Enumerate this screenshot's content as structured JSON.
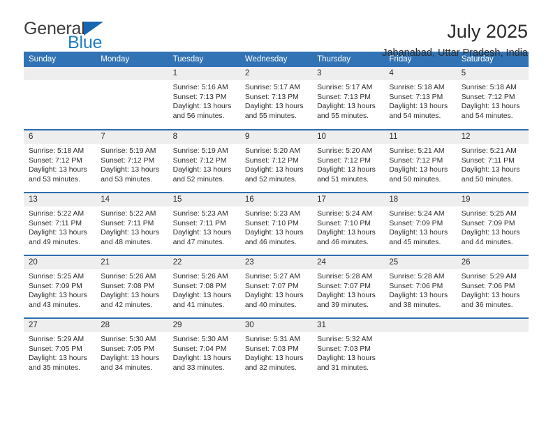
{
  "brand": {
    "name_top": "General",
    "name_bottom": "Blue",
    "triangle_color": "#1665b3",
    "blue_text_color": "#1f7ec4"
  },
  "header": {
    "title": "July 2025",
    "location": "Jahanabad, Uttar Pradesh, India"
  },
  "theme": {
    "header_row_bg": "#3273b5",
    "row_divider": "#2e6daf",
    "daynum_bg": "#eeeeee",
    "text": "#2b2b2b"
  },
  "weekday_headers": [
    "Sunday",
    "Monday",
    "Tuesday",
    "Wednesday",
    "Thursday",
    "Friday",
    "Saturday"
  ],
  "labels": {
    "sunrise_prefix": "Sunrise:",
    "sunset_prefix": "Sunset:",
    "daylight_prefix": "Daylight:"
  },
  "weeks": [
    [
      {
        "day": "",
        "lines": ""
      },
      {
        "day": "",
        "lines": ""
      },
      {
        "day": "1",
        "lines": "Sunrise: 5:16 AM\nSunset: 7:13 PM\nDaylight: 13 hours\nand 56 minutes."
      },
      {
        "day": "2",
        "lines": "Sunrise: 5:17 AM\nSunset: 7:13 PM\nDaylight: 13 hours\nand 55 minutes."
      },
      {
        "day": "3",
        "lines": "Sunrise: 5:17 AM\nSunset: 7:13 PM\nDaylight: 13 hours\nand 55 minutes."
      },
      {
        "day": "4",
        "lines": "Sunrise: 5:18 AM\nSunset: 7:13 PM\nDaylight: 13 hours\nand 54 minutes."
      },
      {
        "day": "5",
        "lines": "Sunrise: 5:18 AM\nSunset: 7:12 PM\nDaylight: 13 hours\nand 54 minutes."
      }
    ],
    [
      {
        "day": "6",
        "lines": "Sunrise: 5:18 AM\nSunset: 7:12 PM\nDaylight: 13 hours\nand 53 minutes."
      },
      {
        "day": "7",
        "lines": "Sunrise: 5:19 AM\nSunset: 7:12 PM\nDaylight: 13 hours\nand 53 minutes."
      },
      {
        "day": "8",
        "lines": "Sunrise: 5:19 AM\nSunset: 7:12 PM\nDaylight: 13 hours\nand 52 minutes."
      },
      {
        "day": "9",
        "lines": "Sunrise: 5:20 AM\nSunset: 7:12 PM\nDaylight: 13 hours\nand 52 minutes."
      },
      {
        "day": "10",
        "lines": "Sunrise: 5:20 AM\nSunset: 7:12 PM\nDaylight: 13 hours\nand 51 minutes."
      },
      {
        "day": "11",
        "lines": "Sunrise: 5:21 AM\nSunset: 7:12 PM\nDaylight: 13 hours\nand 50 minutes."
      },
      {
        "day": "12",
        "lines": "Sunrise: 5:21 AM\nSunset: 7:11 PM\nDaylight: 13 hours\nand 50 minutes."
      }
    ],
    [
      {
        "day": "13",
        "lines": "Sunrise: 5:22 AM\nSunset: 7:11 PM\nDaylight: 13 hours\nand 49 minutes."
      },
      {
        "day": "14",
        "lines": "Sunrise: 5:22 AM\nSunset: 7:11 PM\nDaylight: 13 hours\nand 48 minutes."
      },
      {
        "day": "15",
        "lines": "Sunrise: 5:23 AM\nSunset: 7:11 PM\nDaylight: 13 hours\nand 47 minutes."
      },
      {
        "day": "16",
        "lines": "Sunrise: 5:23 AM\nSunset: 7:10 PM\nDaylight: 13 hours\nand 46 minutes."
      },
      {
        "day": "17",
        "lines": "Sunrise: 5:24 AM\nSunset: 7:10 PM\nDaylight: 13 hours\nand 46 minutes."
      },
      {
        "day": "18",
        "lines": "Sunrise: 5:24 AM\nSunset: 7:09 PM\nDaylight: 13 hours\nand 45 minutes."
      },
      {
        "day": "19",
        "lines": "Sunrise: 5:25 AM\nSunset: 7:09 PM\nDaylight: 13 hours\nand 44 minutes."
      }
    ],
    [
      {
        "day": "20",
        "lines": "Sunrise: 5:25 AM\nSunset: 7:09 PM\nDaylight: 13 hours\nand 43 minutes."
      },
      {
        "day": "21",
        "lines": "Sunrise: 5:26 AM\nSunset: 7:08 PM\nDaylight: 13 hours\nand 42 minutes."
      },
      {
        "day": "22",
        "lines": "Sunrise: 5:26 AM\nSunset: 7:08 PM\nDaylight: 13 hours\nand 41 minutes."
      },
      {
        "day": "23",
        "lines": "Sunrise: 5:27 AM\nSunset: 7:07 PM\nDaylight: 13 hours\nand 40 minutes."
      },
      {
        "day": "24",
        "lines": "Sunrise: 5:28 AM\nSunset: 7:07 PM\nDaylight: 13 hours\nand 39 minutes."
      },
      {
        "day": "25",
        "lines": "Sunrise: 5:28 AM\nSunset: 7:06 PM\nDaylight: 13 hours\nand 38 minutes."
      },
      {
        "day": "26",
        "lines": "Sunrise: 5:29 AM\nSunset: 7:06 PM\nDaylight: 13 hours\nand 36 minutes."
      }
    ],
    [
      {
        "day": "27",
        "lines": "Sunrise: 5:29 AM\nSunset: 7:05 PM\nDaylight: 13 hours\nand 35 minutes."
      },
      {
        "day": "28",
        "lines": "Sunrise: 5:30 AM\nSunset: 7:05 PM\nDaylight: 13 hours\nand 34 minutes."
      },
      {
        "day": "29",
        "lines": "Sunrise: 5:30 AM\nSunset: 7:04 PM\nDaylight: 13 hours\nand 33 minutes."
      },
      {
        "day": "30",
        "lines": "Sunrise: 5:31 AM\nSunset: 7:03 PM\nDaylight: 13 hours\nand 32 minutes."
      },
      {
        "day": "31",
        "lines": "Sunrise: 5:32 AM\nSunset: 7:03 PM\nDaylight: 13 hours\nand 31 minutes."
      },
      {
        "day": "",
        "lines": ""
      },
      {
        "day": "",
        "lines": ""
      }
    ]
  ]
}
